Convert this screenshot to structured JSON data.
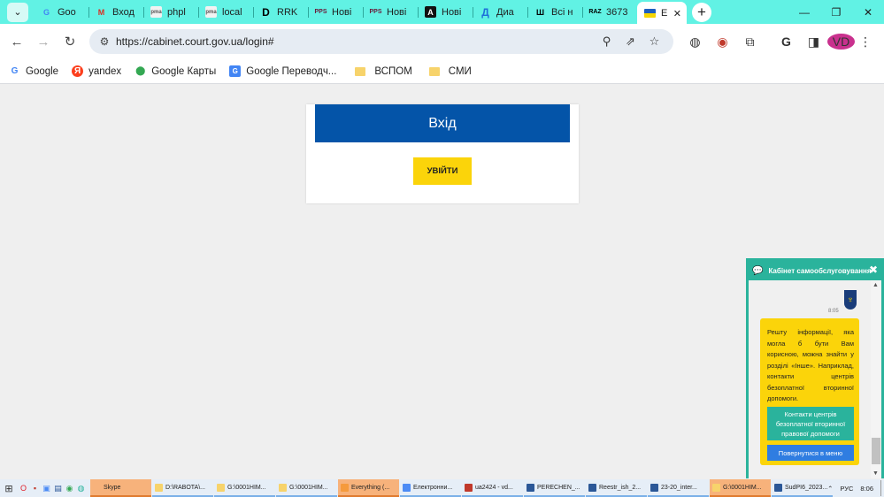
{
  "browser": {
    "tabs": [
      {
        "label": "Goo",
        "icon": "google-icon"
      },
      {
        "label": "Вход",
        "icon": "gmail-icon"
      },
      {
        "label": "phpl",
        "icon": "pma-icon"
      },
      {
        "label": "local",
        "icon": "pma-icon"
      },
      {
        "label": "RRK",
        "icon": "d-icon"
      },
      {
        "label": "Нові",
        "icon": "pps-icon"
      },
      {
        "label": "Нові",
        "icon": "pps-icon"
      },
      {
        "label": "Нові",
        "icon": "a-icon"
      },
      {
        "label": "Диа",
        "icon": "d-icon"
      },
      {
        "label": "Всі н",
        "icon": "shi-icon"
      },
      {
        "label": "3673",
        "icon": "raz-icon"
      },
      {
        "label": "E",
        "icon": "ukraine-flag-icon",
        "active": true
      }
    ],
    "url": "https://cabinet.court.gov.ua/login#",
    "avatar_initials": "VD",
    "bookmarks": [
      {
        "label": "Google",
        "icon": "google-icon"
      },
      {
        "label": "yandex",
        "icon": "yandex-icon"
      },
      {
        "label": "Google Карты",
        "icon": "maps-pin-icon"
      },
      {
        "label": "Google Переводч...",
        "icon": "translate-icon"
      },
      {
        "label": "ВСПОМ",
        "icon": "folder-icon"
      },
      {
        "label": "СМИ",
        "icon": "folder-icon"
      }
    ]
  },
  "login": {
    "title": "Вхід",
    "button": "УВІЙТИ"
  },
  "chat": {
    "title": "Кабінет самообслуговування",
    "time": "8:05",
    "message": "Решту інформації, яка могла б бути Вам корисною, можна знайти у розділі «Інше». Наприклад, контакти центрів безоплатної вторинної допомоги.",
    "btn_contacts": "Контакти центрів безоплатної вторинної правової допомоги",
    "btn_menu": "Повернутися в меню"
  },
  "taskbar": {
    "items": [
      {
        "label": "Skype",
        "color": "#f7b27b",
        "highlight": true
      },
      {
        "label": "D:\\RABOTA\\...",
        "color": "#f7d36b"
      },
      {
        "label": "G:\\0001HIM...",
        "color": "#f7d36b"
      },
      {
        "label": "G:\\0001HIM...",
        "color": "#f7d36b"
      },
      {
        "label": "Everything (...",
        "color": "#f59a3c",
        "highlight": true
      },
      {
        "label": "Електронни...",
        "color": "#4b8bf5"
      },
      {
        "label": "ua2424 - vd...",
        "color": "#c0392b"
      },
      {
        "label": "PERECHEN_...",
        "color": "#2b5797"
      },
      {
        "label": "Reestr_ish_2...",
        "color": "#2b5797"
      },
      {
        "label": "23-20_inter...",
        "color": "#2b5797"
      },
      {
        "label": "G:\\0001HIM...",
        "color": "#f7d36b",
        "highlight": true
      },
      {
        "label": "SudPI6_2023...",
        "color": "#2b5797"
      }
    ],
    "lang": "РУС",
    "clock": "8:06"
  }
}
